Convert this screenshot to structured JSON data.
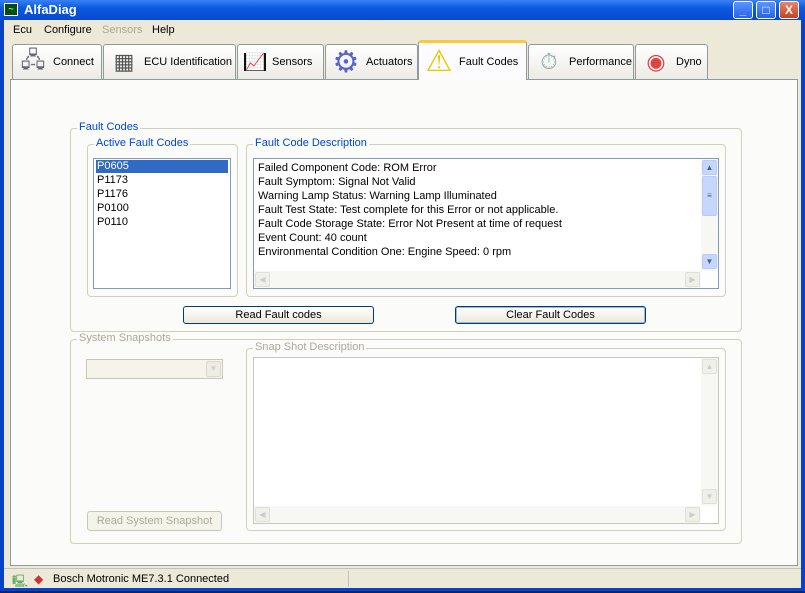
{
  "window": {
    "title": "AlfaDiag",
    "minimize": "_",
    "maximize": "□",
    "close": "X"
  },
  "menu": [
    "Ecu",
    "Configure",
    "Sensors",
    "Help"
  ],
  "tabs": [
    {
      "label": "Connect",
      "icon": "🖧"
    },
    {
      "label": "ECU Identification",
      "icon": "▦"
    },
    {
      "label": "Sensors",
      "icon": "📈"
    },
    {
      "label": "Actuators",
      "icon": "⚙"
    },
    {
      "label": "Fault Codes",
      "icon": "⚠"
    },
    {
      "label": "Performance",
      "icon": "⏱"
    },
    {
      "label": "Dyno",
      "icon": "◉"
    }
  ],
  "fault_codes": {
    "group": "Fault Codes",
    "active_group": "Active Fault Codes",
    "codes": [
      "P0605",
      "P1173",
      "P1176",
      "P0100",
      "P0110"
    ],
    "selected": "P0605",
    "desc_group": "Fault Code Description",
    "description": [
      "Failed Component Code: ROM Error",
      "Fault Symptom: Signal Not Valid",
      "Warning Lamp Status: Warning Lamp Illuminated",
      "Fault Test State: Test complete for this Error or not applicable.",
      "Fault Code Storage State: Error Not Present at time of request",
      "Event Count: 40 count",
      "Environmental Condition One: Engine Speed: 0 rpm"
    ],
    "read_button": "Read Fault codes",
    "clear_button": "Clear Fault Codes"
  },
  "snapshots": {
    "group": "System Snapshots",
    "desc_group": "Snap Shot Description",
    "read_button": "Read System Snapshot"
  },
  "status": {
    "text": "Bosch Motronic ME7.3.1 Connected"
  }
}
